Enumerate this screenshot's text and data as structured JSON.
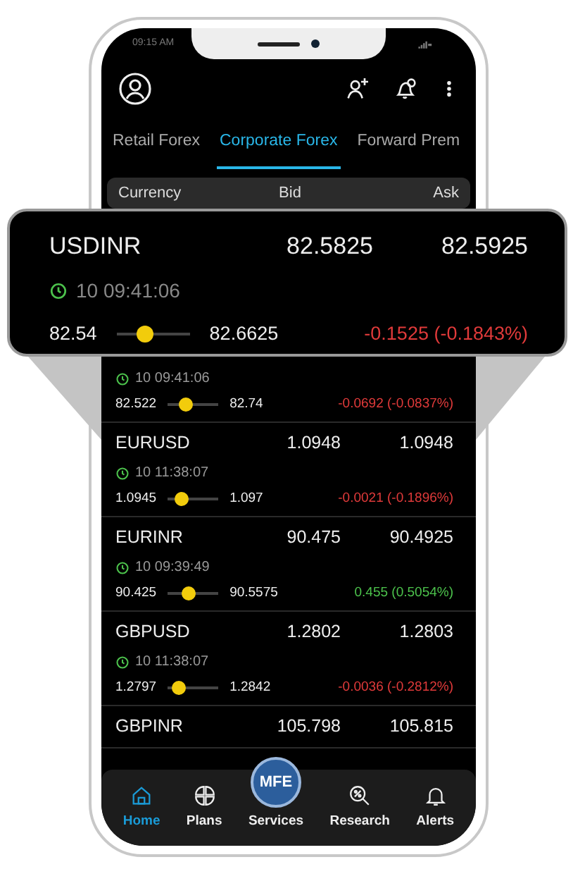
{
  "status_bar": {
    "time": "09:15 AM"
  },
  "tabs": [
    {
      "label": "Retail Forex",
      "selected": false
    },
    {
      "label": "Corporate Forex",
      "selected": true
    },
    {
      "label": "Forward Prem",
      "selected": false
    }
  ],
  "columns": [
    "Currency",
    "Bid",
    "Ask"
  ],
  "callout": {
    "pair": "USDINR",
    "bid": "82.5825",
    "ask": "82.5925",
    "time": "10 09:41:06",
    "low": "82.54",
    "high": "82.6625",
    "level": 0.35,
    "change": "-0.1525 (-0.1843%)",
    "color": "#e03a3a"
  },
  "quotes": [
    {
      "time": "10 09:41:06",
      "low": "82.522",
      "high": "82.74",
      "level": 0.3,
      "change": "-0.0692 (-0.0837%)",
      "color": "#e03a3a"
    },
    {
      "pair": "EURUSD",
      "bid": "1.0948",
      "ask": "1.0948",
      "time": "10 11:38:07",
      "low": "1.0945",
      "high": "1.097",
      "level": 0.2,
      "change": "-0.0021 (-0.1896%)",
      "color": "#e03a3a"
    },
    {
      "pair": "EURINR",
      "bid": "90.475",
      "ask": "90.4925",
      "time": "10 09:39:49",
      "low": "90.425",
      "high": "90.5575",
      "level": 0.4,
      "change": "0.455 (0.5054%)",
      "color": "#4cc24c"
    },
    {
      "pair": "GBPUSD",
      "bid": "1.2802",
      "ask": "1.2803",
      "time": "10 11:38:07",
      "low": "1.2797",
      "high": "1.2842",
      "level": 0.1,
      "change": "-0.0036 (-0.2812%)",
      "color": "#e03a3a"
    },
    {
      "pair": "GBPINR",
      "bid": "105.798",
      "ask": "105.815"
    }
  ],
  "nav": [
    {
      "kind": "home",
      "label": "Home",
      "selected": true
    },
    {
      "kind": "plans",
      "label": "Plans",
      "selected": false
    },
    {
      "kind": "badge",
      "badge": "MFE",
      "label": "Services",
      "selected": false
    },
    {
      "kind": "research",
      "label": "Research",
      "selected": false
    },
    {
      "kind": "alerts",
      "label": "Alerts",
      "selected": false
    }
  ]
}
